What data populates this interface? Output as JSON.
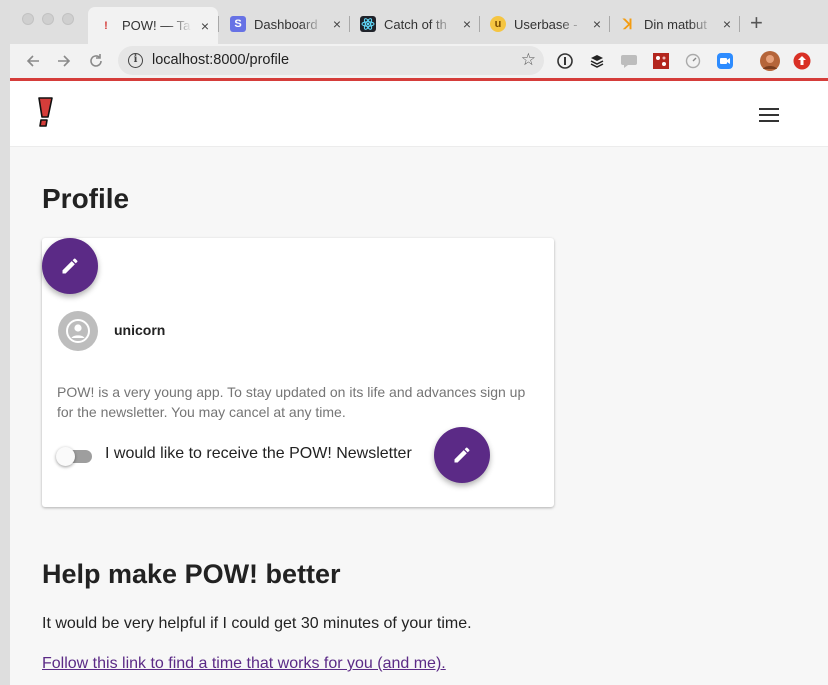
{
  "browser": {
    "tabs": [
      {
        "label": "POW! — Ta",
        "icon": "pow-favicon",
        "active": true
      },
      {
        "label": "Dashboard",
        "icon": "stripe-favicon",
        "active": false
      },
      {
        "label": "Catch of th",
        "icon": "react-favicon",
        "active": false
      },
      {
        "label": "Userbase -",
        "icon": "userbase-favicon",
        "active": false
      },
      {
        "label": "Din matbut",
        "icon": "matbut-favicon",
        "active": false
      }
    ],
    "close_glyph": "×",
    "new_tab_glyph": "+",
    "url": "localhost:8000/profile",
    "accent_color": "#d53d3a"
  },
  "app": {
    "brand_color": "#5b2a86"
  },
  "profile": {
    "title": "Profile",
    "username": "unicorn",
    "description": "POW! is a very young app. To stay updated on its life and advances sign up for the newsletter. You may cancel at any time.",
    "newsletter_label": "I would like to receive the POW! Newsletter",
    "newsletter_enabled": false
  },
  "help": {
    "title": "Help make POW! better",
    "text": "It would be very helpful if I could get 30 minutes of your time.",
    "link_text": "Follow this link to find a time that works for you (and me)."
  }
}
